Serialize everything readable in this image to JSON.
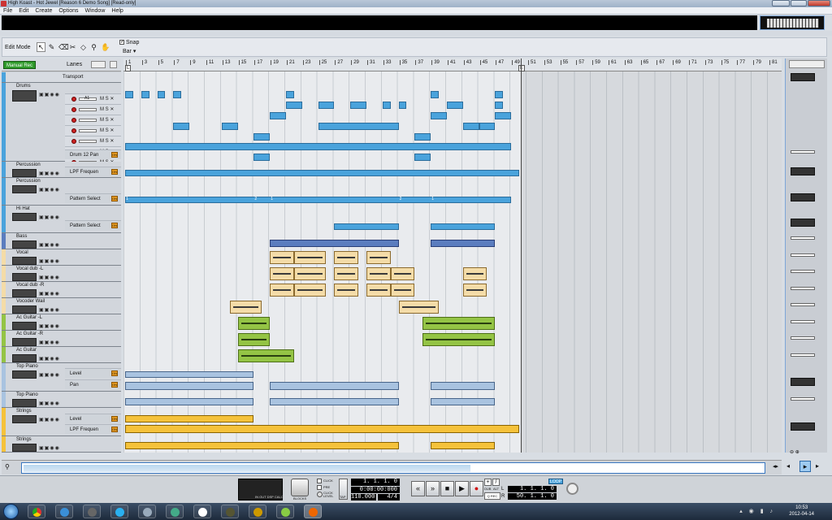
{
  "window": {
    "title": "High Koast - Hot Jewel [Reason 6 Demo Song] [Read-only]"
  },
  "menu": [
    "File",
    "Edit",
    "Create",
    "Options",
    "Window",
    "Help"
  ],
  "toolbar": {
    "edit_mode": "Edit Mode",
    "snap_label": "Snap",
    "snap_checked": "✓",
    "snap_value": "Bar"
  },
  "sequencer": {
    "manual_rec": "Manual Rec",
    "lanes": "Lanes",
    "ruler_ticks": [
      "1",
      "3",
      "5",
      "7",
      "9",
      "11",
      "13",
      "15",
      "17",
      "19",
      "21",
      "23",
      "25",
      "27",
      "29",
      "31",
      "33",
      "35",
      "37",
      "39",
      "41",
      "43",
      "45",
      "47",
      "49",
      "51",
      "53",
      "55",
      "57",
      "59",
      "61",
      "63",
      "65",
      "67",
      "69",
      "71",
      "73",
      "75",
      "77",
      "79",
      "81"
    ],
    "marker_l": "L",
    "marker_r": "R",
    "marker_e": "E"
  },
  "tracks": [
    {
      "name": "Transport",
      "color": "#4aa3dc"
    },
    {
      "name": "Drums",
      "color": "#4aa3dc",
      "lane_labels": [
        "A1"
      ],
      "param": "Drum 12 Pan"
    },
    {
      "name": "Percussion",
      "color": "#4aa3dc",
      "param": "LPF Frequen"
    },
    {
      "name": "Percussion",
      "color": "#4aa3dc",
      "param": "Pattern Select"
    },
    {
      "name": "Hi Hat",
      "color": "#4aa3dc",
      "param": "Pattern Select"
    },
    {
      "name": "Bass",
      "color": "#5b7dbf"
    },
    {
      "name": "Vocal",
      "color": "#f4dca8"
    },
    {
      "name": "Vocal dub -L",
      "color": "#f4dca8"
    },
    {
      "name": "Vocal dub -R",
      "color": "#f4dca8"
    },
    {
      "name": "Vocoder Wail",
      "color": "#f4dca8"
    },
    {
      "name": "Ac Guitar -L",
      "color": "#94c445"
    },
    {
      "name": "Ac Guitar -R",
      "color": "#94c445"
    },
    {
      "name": "Ac Guitar",
      "color": "#94c445"
    },
    {
      "name": "Top Piano",
      "color": "#a9c3e0",
      "param": "Level",
      "param2": "Pan"
    },
    {
      "name": "Top Piano",
      "color": "#a9c3e0"
    },
    {
      "name": "Strings",
      "color": "#f5c23b",
      "param": "Level",
      "param2": "LPF Frequen"
    },
    {
      "name": "Strings",
      "color": "#f5c23b"
    }
  ],
  "pattern_labels": {
    "a": "1",
    "b": "2",
    "c": "1",
    "d": "2",
    "e": "1"
  },
  "transport": {
    "dsp_labels": [
      "IN",
      "OUT",
      "DSP",
      "CALC"
    ],
    "blocks": "BLOCKS",
    "click": "CLICK",
    "pre": "PRE",
    "click_level": "CLICK LEVEL",
    "tap": "TAP",
    "position": "1. 1. 1. 0",
    "time": "0:00:00:000",
    "tempo": "110.000",
    "signature": "4/4",
    "dub": "DUB",
    "alt": "ALT",
    "q_rec": "Q REC",
    "loop": "LOOP",
    "loop_l": "1. 1. 1. 0",
    "loop_r": "50. 1. 1. 0",
    "l": "L",
    "r": "R"
  },
  "taskbar": {
    "time": "10:53",
    "date": "2012-04-14"
  }
}
